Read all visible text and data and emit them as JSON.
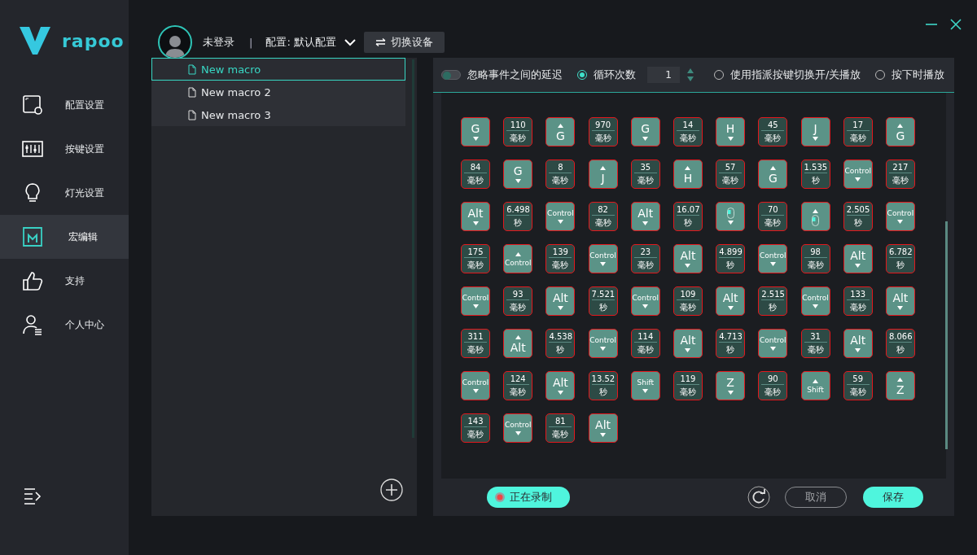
{
  "brand": {
    "name": "rapoo"
  },
  "sidebar": {
    "items": [
      {
        "label": "配置设置",
        "selected": false
      },
      {
        "label": "按键设置",
        "selected": false
      },
      {
        "label": "灯光设置",
        "selected": false
      },
      {
        "label": "宏编辑",
        "selected": true
      },
      {
        "label": "支持",
        "selected": false
      },
      {
        "label": "个人中心",
        "selected": false
      }
    ]
  },
  "header": {
    "user": "未登录",
    "separator": "|",
    "profile": "配置: 默认配置",
    "switch_button": "切换设备"
  },
  "macros": [
    {
      "name": "New macro",
      "selected": true
    },
    {
      "name": "New macro 2",
      "selected": false
    },
    {
      "name": "New macro 3",
      "selected": false
    }
  ],
  "options": {
    "ignore_delay": {
      "label": "忽略事件之间的延迟",
      "on": false
    },
    "play_modes": [
      {
        "kind": "loop",
        "label": "循环次数",
        "selected": true,
        "count": "1"
      },
      {
        "kind": "plain",
        "label": "使用指派按键切换开/关播放",
        "selected": false
      },
      {
        "kind": "plain",
        "label": "按下时播放",
        "selected": false
      }
    ]
  },
  "events": [
    {
      "kind": "key",
      "label": "G",
      "released": false
    },
    {
      "kind": "delay",
      "value": "110",
      "unit": "毫秒"
    },
    {
      "kind": "key",
      "label": "G",
      "released": true
    },
    {
      "kind": "delay",
      "value": "970",
      "unit": "毫秒"
    },
    {
      "kind": "key",
      "label": "G",
      "released": false
    },
    {
      "kind": "delay",
      "value": "14",
      "unit": "毫秒"
    },
    {
      "kind": "key",
      "label": "H",
      "released": false
    },
    {
      "kind": "delay",
      "value": "45",
      "unit": "毫秒"
    },
    {
      "kind": "key",
      "label": "J",
      "released": false
    },
    {
      "kind": "delay",
      "value": "17",
      "unit": "毫秒"
    },
    {
      "kind": "key",
      "label": "G",
      "released": true
    },
    {
      "kind": "delay",
      "value": "84",
      "unit": "毫秒"
    },
    {
      "kind": "key",
      "label": "G",
      "released": false
    },
    {
      "kind": "delay",
      "value": "8",
      "unit": "毫秒"
    },
    {
      "kind": "key",
      "label": "J",
      "released": true
    },
    {
      "kind": "delay",
      "value": "35",
      "unit": "毫秒"
    },
    {
      "kind": "key",
      "label": "H",
      "released": true
    },
    {
      "kind": "delay",
      "value": "57",
      "unit": "毫秒"
    },
    {
      "kind": "key",
      "label": "G",
      "released": true
    },
    {
      "kind": "delay",
      "value": "1.535",
      "unit": "秒"
    },
    {
      "kind": "key",
      "label": "Control",
      "released": false
    },
    {
      "kind": "delay",
      "value": "217",
      "unit": "毫秒"
    },
    {
      "kind": "key",
      "label": "Alt",
      "released": false
    },
    {
      "kind": "delay",
      "value": "6.498",
      "unit": "秒"
    },
    {
      "kind": "key",
      "label": "Control",
      "released": false
    },
    {
      "kind": "delay",
      "value": "82",
      "unit": "毫秒"
    },
    {
      "kind": "key",
      "label": "Alt",
      "released": false
    },
    {
      "kind": "delay",
      "value": "16.07",
      "unit": "秒"
    },
    {
      "kind": "mouse",
      "released": false
    },
    {
      "kind": "delay",
      "value": "70",
      "unit": "毫秒"
    },
    {
      "kind": "mouse",
      "released": true
    },
    {
      "kind": "delay",
      "value": "2.505",
      "unit": "秒"
    },
    {
      "kind": "key",
      "label": "Control",
      "released": false
    },
    {
      "kind": "delay",
      "value": "175",
      "unit": "毫秒"
    },
    {
      "kind": "key",
      "label": "Control",
      "released": true
    },
    {
      "kind": "delay",
      "value": "139",
      "unit": "毫秒"
    },
    {
      "kind": "key",
      "label": "Control",
      "released": false
    },
    {
      "kind": "delay",
      "value": "23",
      "unit": "毫秒"
    },
    {
      "kind": "key",
      "label": "Alt",
      "released": false
    },
    {
      "kind": "delay",
      "value": "4.899",
      "unit": "秒"
    },
    {
      "kind": "key",
      "label": "Control",
      "released": false
    },
    {
      "kind": "delay",
      "value": "98",
      "unit": "毫秒"
    },
    {
      "kind": "key",
      "label": "Alt",
      "released": false
    },
    {
      "kind": "delay",
      "value": "6.782",
      "unit": "秒"
    },
    {
      "kind": "key",
      "label": "Control",
      "released": false
    },
    {
      "kind": "delay",
      "value": "93",
      "unit": "毫秒"
    },
    {
      "kind": "key",
      "label": "Alt",
      "released": false
    },
    {
      "kind": "delay",
      "value": "7.521",
      "unit": "秒"
    },
    {
      "kind": "key",
      "label": "Control",
      "released": false
    },
    {
      "kind": "delay",
      "value": "109",
      "unit": "毫秒"
    },
    {
      "kind": "key",
      "label": "Alt",
      "released": false
    },
    {
      "kind": "delay",
      "value": "2.515",
      "unit": "秒"
    },
    {
      "kind": "key",
      "label": "Control",
      "released": false
    },
    {
      "kind": "delay",
      "value": "133",
      "unit": "毫秒"
    },
    {
      "kind": "key",
      "label": "Alt",
      "released": false
    },
    {
      "kind": "delay",
      "value": "311",
      "unit": "毫秒"
    },
    {
      "kind": "key",
      "label": "Alt",
      "released": true
    },
    {
      "kind": "delay",
      "value": "4.538",
      "unit": "秒"
    },
    {
      "kind": "key",
      "label": "Control",
      "released": false
    },
    {
      "kind": "delay",
      "value": "114",
      "unit": "毫秒"
    },
    {
      "kind": "key",
      "label": "Alt",
      "released": false
    },
    {
      "kind": "delay",
      "value": "4.713",
      "unit": "秒"
    },
    {
      "kind": "key",
      "label": "Control",
      "released": false
    },
    {
      "kind": "delay",
      "value": "31",
      "unit": "毫秒"
    },
    {
      "kind": "key",
      "label": "Alt",
      "released": false
    },
    {
      "kind": "delay",
      "value": "8.066",
      "unit": "秒"
    },
    {
      "kind": "key",
      "label": "Control",
      "released": false
    },
    {
      "kind": "delay",
      "value": "124",
      "unit": "毫秒"
    },
    {
      "kind": "key",
      "label": "Alt",
      "released": false
    },
    {
      "kind": "delay",
      "value": "13.52",
      "unit": "秒"
    },
    {
      "kind": "key",
      "label": "Shift",
      "released": false
    },
    {
      "kind": "delay",
      "value": "119",
      "unit": "毫秒"
    },
    {
      "kind": "key",
      "label": "Z",
      "released": false
    },
    {
      "kind": "delay",
      "value": "90",
      "unit": "毫秒"
    },
    {
      "kind": "key",
      "label": "Shift",
      "released": true
    },
    {
      "kind": "delay",
      "value": "59",
      "unit": "毫秒"
    },
    {
      "kind": "key",
      "label": "Z",
      "released": true
    },
    {
      "kind": "delay",
      "value": "143",
      "unit": "毫秒"
    },
    {
      "kind": "key",
      "label": "Control",
      "released": false
    },
    {
      "kind": "delay",
      "value": "81",
      "unit": "毫秒"
    },
    {
      "kind": "key",
      "label": "Alt",
      "released": false
    }
  ],
  "footer": {
    "record": "正在录制",
    "cancel": "取消",
    "save": "保存"
  }
}
